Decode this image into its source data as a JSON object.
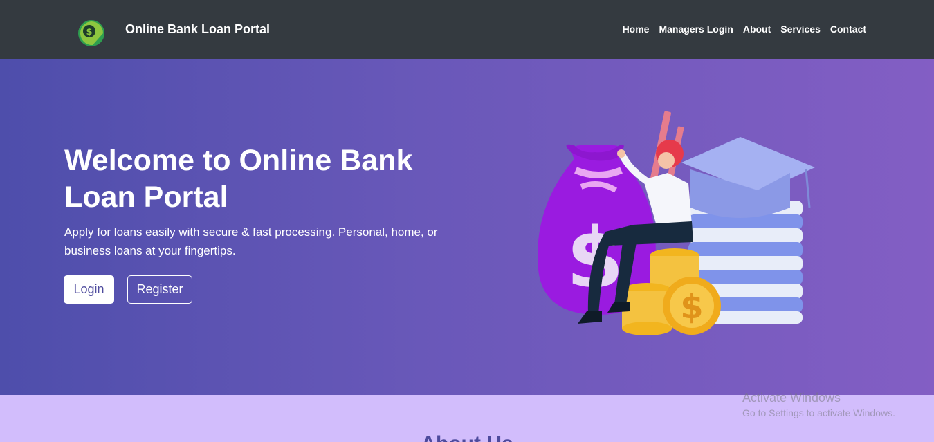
{
  "navbar": {
    "brand_title": "Online Bank Loan Portal",
    "logo_icon": "dollar-leaf-icon",
    "links": [
      "Home",
      "Managers Login",
      "About",
      "Services",
      "Contact"
    ]
  },
  "hero": {
    "title": "Welcome to Online Bank Loan Portal",
    "subtitle": "Apply for loans easily with secure & fast processing. Personal, home, or business loans at your fingertips.",
    "login_label": "Login",
    "register_label": "Register",
    "illustration": "money-bag-books-coins-illustration"
  },
  "about": {
    "heading": "About Us"
  },
  "watermark": {
    "title": "Activate Windows",
    "subtitle": "Go to Settings to activate Windows."
  },
  "colors": {
    "navbar_bg": "#343a40",
    "hero_start": "#4e4eab",
    "hero_end": "#835ec4",
    "about_bg": "#d2bdfc",
    "accent_text": "#4e4b9d"
  }
}
